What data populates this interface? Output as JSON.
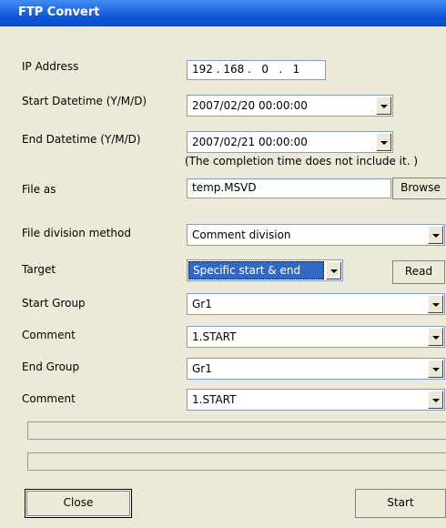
{
  "window": {
    "title": "FTP Convert"
  },
  "form": {
    "ip_label": "IP Address",
    "ip_value": "192 . 168 .   0   .   1",
    "start_dt_label": "Start Datetime (Y/M/D)",
    "start_dt_value": "2007/02/20 00:00:00",
    "end_dt_label": "End Datetime (Y/M/D)",
    "end_dt_value": "2007/02/21 00:00:00",
    "end_note": "(The completion time does not include it. )",
    "file_as_label": "File as",
    "file_as_value": "temp.MSVD",
    "browse_label": "Browse",
    "division_label": "File division method",
    "division_value": "Comment division",
    "target_label": "Target",
    "target_value": "Specific start & end",
    "read_label": "Read",
    "start_group_label": "Start Group",
    "start_group_value": "Gr1",
    "start_comment_label": "Comment",
    "start_comment_value": "1.START",
    "end_group_label": "End Group",
    "end_group_value": "Gr1",
    "end_comment_label": "Comment",
    "end_comment_value": "1.START"
  },
  "buttons": {
    "close": "Close",
    "start": "Start"
  }
}
